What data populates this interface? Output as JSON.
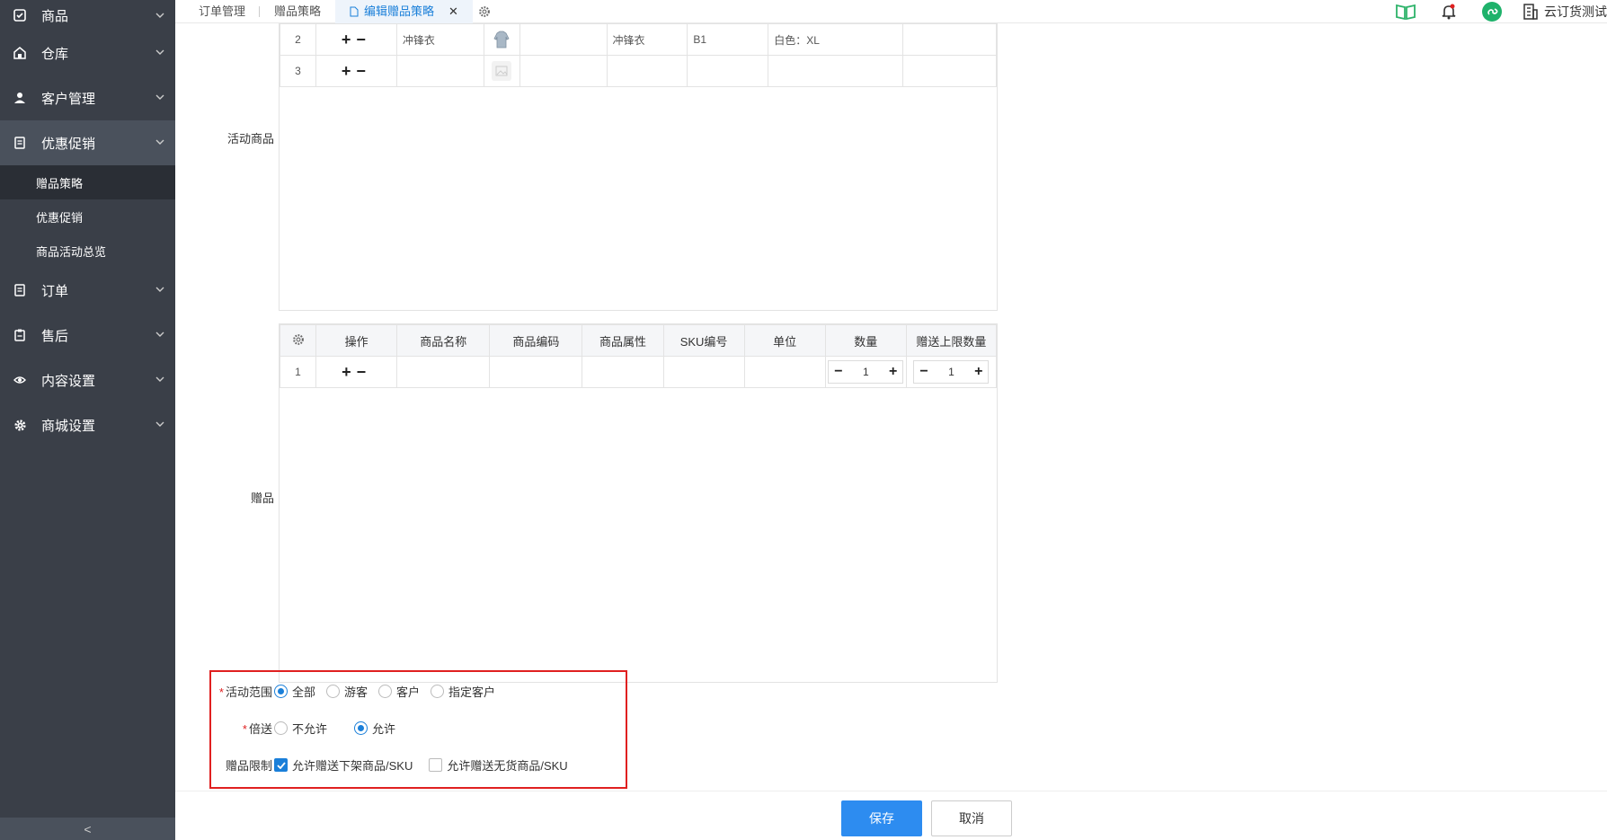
{
  "sidebar": {
    "items": [
      {
        "label": "商品",
        "icon": "product-icon"
      },
      {
        "label": "仓库",
        "icon": "warehouse-icon"
      },
      {
        "label": "客户管理",
        "icon": "customer-icon"
      },
      {
        "label": "优惠促销",
        "icon": "promotion-icon"
      },
      {
        "label": "订单",
        "icon": "order-icon"
      },
      {
        "label": "售后",
        "icon": "aftersale-icon"
      },
      {
        "label": "内容设置",
        "icon": "eye-icon"
      },
      {
        "label": "商城设置",
        "icon": "gear-icon"
      }
    ],
    "sub_items": [
      {
        "label": "赠品策略"
      },
      {
        "label": "优惠促销"
      },
      {
        "label": "商品活动总览"
      }
    ],
    "collapse_glyph": "<"
  },
  "tabs": [
    {
      "label": "订单管理"
    },
    {
      "label": "赠品策略"
    },
    {
      "label": "编辑赠品策略"
    }
  ],
  "user": {
    "name": "云订货测试"
  },
  "activity_goods": {
    "label": "活动商品",
    "rows": [
      {
        "index": "2",
        "name": "冲锋衣",
        "code": "冲锋衣",
        "sku": "B1",
        "attr": "白色：XL"
      },
      {
        "index": "3",
        "name": "",
        "code": "",
        "sku": "",
        "attr": ""
      }
    ]
  },
  "gifts": {
    "label": "赠品",
    "headers": [
      "操作",
      "商品名称",
      "商品编码",
      "商品属性",
      "SKU编号",
      "单位",
      "数量",
      "赠送上限数量"
    ],
    "rows": [
      {
        "index": "1",
        "qty": "1",
        "limit": "1"
      }
    ]
  },
  "form": {
    "scope_label": "活动范围",
    "scope_options": [
      "全部",
      "游客",
      "客户",
      "指定客户"
    ],
    "scope_selected": "全部",
    "multiple_label": "倍送",
    "multiple_options": [
      "不允许",
      "允许"
    ],
    "multiple_selected": "允许",
    "limit_label": "赠品限制",
    "limit_options": [
      "允许赠送下架商品/SKU",
      "允许赠送无货商品/SKU"
    ],
    "limit_checked": [
      "允许赠送下架商品/SKU"
    ],
    "required_mark": "*"
  },
  "buttons": {
    "save": "保存",
    "cancel": "取消"
  },
  "colors": {
    "accent": "#2d8cf0",
    "sidebar": "#3a3f48",
    "highlight_border": "#e02020"
  }
}
